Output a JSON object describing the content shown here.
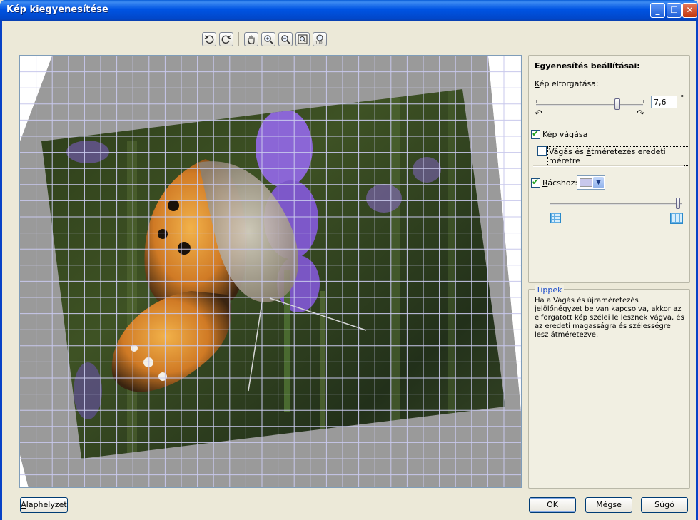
{
  "window": {
    "title": "Kép kiegyenesítése"
  },
  "settings": {
    "heading": "Egyenesítés beállításai:",
    "rotation_label_prefix": "K",
    "rotation_label_rest": "ép elforgatása:",
    "rotation_value": "7,6",
    "rotation_unit": "°",
    "crop_label_prefix": "K",
    "crop_label_rest": "ép vágása",
    "crop_checked": true,
    "resize_label_a": "Vágás és ",
    "resize_label_u": "á",
    "resize_label_b": "tméretezés eredeti méretre",
    "resize_checked": false,
    "grid_label_prefix": "R",
    "grid_label_rest": "ácshoz:",
    "grid_checked": true,
    "grid_color": "#c8c8ec"
  },
  "tips": {
    "title": "Tippek",
    "text": "Ha a Vágás és újraméretezés jelölőnégyzet be van kapcsolva, akkor az elforgatott kép szélei le lesznek vágva, és az eredeti magasságra és szélességre lesz átméretezve."
  },
  "buttons": {
    "reset_prefix": "A",
    "reset_rest": "laphelyzet",
    "ok": "OK",
    "cancel": "Mégse",
    "help": "Súgó"
  },
  "toolbar_icons": [
    "rotate-left-icon",
    "rotate-right-icon",
    "hand-pan-icon",
    "zoom-in-icon",
    "zoom-out-icon",
    "zoom-fit-icon",
    "zoom-100-icon"
  ]
}
